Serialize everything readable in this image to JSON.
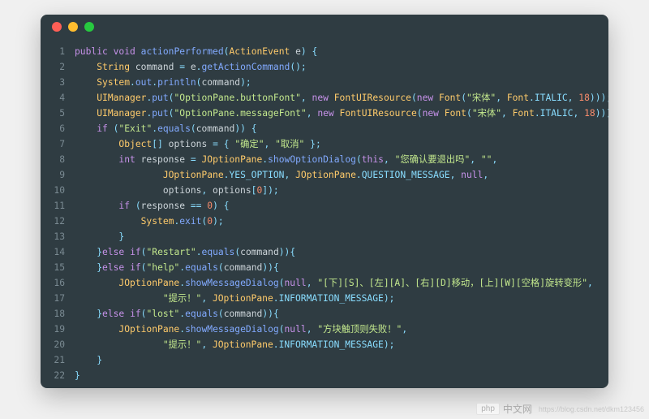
{
  "window": {
    "dots": [
      "red",
      "yellow",
      "green"
    ]
  },
  "code": {
    "lines": [
      {
        "n": 1,
        "tokens": [
          [
            "kw",
            "public"
          ],
          [
            "",
            ""
          ],
          [
            "kw",
            " void"
          ],
          [
            "",
            " "
          ],
          [
            "field",
            "actionPerformed"
          ],
          [
            "punct",
            "("
          ],
          [
            "type",
            "ActionEvent"
          ],
          [
            "",
            " e"
          ],
          [
            "punct",
            ")"
          ],
          [
            "",
            " "
          ],
          [
            "punct",
            "{"
          ]
        ]
      },
      {
        "n": 2,
        "tokens": [
          [
            "",
            "    "
          ],
          [
            "type",
            "String"
          ],
          [
            "",
            " command "
          ],
          [
            "punct",
            "="
          ],
          [
            "",
            " e"
          ],
          [
            "punct",
            "."
          ],
          [
            "field",
            "getActionCommand"
          ],
          [
            "punct",
            "();"
          ]
        ]
      },
      {
        "n": 3,
        "tokens": [
          [
            "",
            "    "
          ],
          [
            "type",
            "System"
          ],
          [
            "punct",
            "."
          ],
          [
            "field",
            "out"
          ],
          [
            "punct",
            "."
          ],
          [
            "field",
            "println"
          ],
          [
            "punct",
            "("
          ],
          [
            "",
            "command"
          ],
          [
            "punct",
            ");"
          ]
        ]
      },
      {
        "n": 4,
        "tokens": [
          [
            "",
            "    "
          ],
          [
            "type",
            "UIManager"
          ],
          [
            "punct",
            "."
          ],
          [
            "field",
            "put"
          ],
          [
            "punct",
            "("
          ],
          [
            "str",
            "\"OptionPane.buttonFont\""
          ],
          [
            "punct",
            ", "
          ],
          [
            "kw",
            "new"
          ],
          [
            "",
            " "
          ],
          [
            "type",
            "FontUIResource"
          ],
          [
            "punct",
            "("
          ],
          [
            "kw",
            "new"
          ],
          [
            "",
            " "
          ],
          [
            "type",
            "Font"
          ],
          [
            "punct",
            "("
          ],
          [
            "str",
            "\"宋体\""
          ],
          [
            "punct",
            ", "
          ],
          [
            "type",
            "Font"
          ],
          [
            "punct",
            "."
          ],
          [
            "const",
            "ITALIC"
          ],
          [
            "punct",
            ", "
          ],
          [
            "num",
            "18"
          ],
          [
            "punct",
            ")));"
          ]
        ]
      },
      {
        "n": 5,
        "tokens": [
          [
            "",
            "    "
          ],
          [
            "type",
            "UIManager"
          ],
          [
            "punct",
            "."
          ],
          [
            "field",
            "put"
          ],
          [
            "punct",
            "("
          ],
          [
            "str",
            "\"OptionPane.messageFont\""
          ],
          [
            "punct",
            ", "
          ],
          [
            "kw",
            "new"
          ],
          [
            "",
            " "
          ],
          [
            "type",
            "FontUIResource"
          ],
          [
            "punct",
            "("
          ],
          [
            "kw",
            "new"
          ],
          [
            "",
            " "
          ],
          [
            "type",
            "Font"
          ],
          [
            "punct",
            "("
          ],
          [
            "str",
            "\"宋体\""
          ],
          [
            "punct",
            ", "
          ],
          [
            "type",
            "Font"
          ],
          [
            "punct",
            "."
          ],
          [
            "const",
            "ITALIC"
          ],
          [
            "punct",
            ", "
          ],
          [
            "num",
            "18"
          ],
          [
            "punct",
            ")));"
          ]
        ]
      },
      {
        "n": 6,
        "tokens": [
          [
            "",
            "    "
          ],
          [
            "kw",
            "if"
          ],
          [
            "",
            " "
          ],
          [
            "punct",
            "("
          ],
          [
            "str",
            "\"Exit\""
          ],
          [
            "punct",
            "."
          ],
          [
            "field",
            "equals"
          ],
          [
            "punct",
            "("
          ],
          [
            "",
            "command"
          ],
          [
            "punct",
            "))"
          ],
          [
            "",
            " "
          ],
          [
            "punct",
            "{"
          ]
        ]
      },
      {
        "n": 7,
        "tokens": [
          [
            "",
            "        "
          ],
          [
            "type",
            "Object"
          ],
          [
            "punct",
            "[]"
          ],
          [
            "",
            " options "
          ],
          [
            "punct",
            "="
          ],
          [
            "",
            " "
          ],
          [
            "punct",
            "{"
          ],
          [
            "",
            " "
          ],
          [
            "str",
            "\"确定\""
          ],
          [
            "punct",
            ", "
          ],
          [
            "str",
            "\"取消\""
          ],
          [
            "",
            " "
          ],
          [
            "punct",
            "};"
          ]
        ]
      },
      {
        "n": 8,
        "tokens": [
          [
            "",
            "        "
          ],
          [
            "kw",
            "int"
          ],
          [
            "",
            " response "
          ],
          [
            "punct",
            "="
          ],
          [
            "",
            " "
          ],
          [
            "type",
            "JOptionPane"
          ],
          [
            "punct",
            "."
          ],
          [
            "field",
            "showOptionDialog"
          ],
          [
            "punct",
            "("
          ],
          [
            "kw",
            "this"
          ],
          [
            "punct",
            ", "
          ],
          [
            "str",
            "\"您确认要退出吗\""
          ],
          [
            "punct",
            ", "
          ],
          [
            "str",
            "\"\""
          ],
          [
            "punct",
            ","
          ]
        ]
      },
      {
        "n": 9,
        "tokens": [
          [
            "",
            "                "
          ],
          [
            "type",
            "JOptionPane"
          ],
          [
            "punct",
            "."
          ],
          [
            "const",
            "YES_OPTION"
          ],
          [
            "punct",
            ", "
          ],
          [
            "type",
            "JOptionPane"
          ],
          [
            "punct",
            "."
          ],
          [
            "const",
            "QUESTION_MESSAGE"
          ],
          [
            "punct",
            ", "
          ],
          [
            "null",
            "null"
          ],
          [
            "punct",
            ","
          ]
        ]
      },
      {
        "n": 10,
        "tokens": [
          [
            "",
            "                options"
          ],
          [
            "punct",
            ", "
          ],
          [
            "",
            "options"
          ],
          [
            "punct",
            "["
          ],
          [
            "num",
            "0"
          ],
          [
            "punct",
            "]);"
          ]
        ]
      },
      {
        "n": 11,
        "tokens": [
          [
            "",
            "        "
          ],
          [
            "kw",
            "if"
          ],
          [
            "",
            " "
          ],
          [
            "punct",
            "("
          ],
          [
            "",
            "response "
          ],
          [
            "punct",
            "=="
          ],
          [
            "",
            " "
          ],
          [
            "num",
            "0"
          ],
          [
            "punct",
            ")"
          ],
          [
            "",
            " "
          ],
          [
            "punct",
            "{"
          ]
        ]
      },
      {
        "n": 12,
        "tokens": [
          [
            "",
            "            "
          ],
          [
            "type",
            "System"
          ],
          [
            "punct",
            "."
          ],
          [
            "field",
            "exit"
          ],
          [
            "punct",
            "("
          ],
          [
            "num",
            "0"
          ],
          [
            "punct",
            ");"
          ]
        ]
      },
      {
        "n": 13,
        "tokens": [
          [
            "",
            "        "
          ],
          [
            "punct",
            "}"
          ]
        ]
      },
      {
        "n": 14,
        "tokens": [
          [
            "",
            "    "
          ],
          [
            "punct",
            "}"
          ],
          [
            "kw",
            "else"
          ],
          [
            "",
            " "
          ],
          [
            "kw",
            "if"
          ],
          [
            "punct",
            "("
          ],
          [
            "str",
            "\"Restart\""
          ],
          [
            "punct",
            "."
          ],
          [
            "field",
            "equals"
          ],
          [
            "punct",
            "("
          ],
          [
            "",
            "command"
          ],
          [
            "punct",
            ")){"
          ]
        ]
      },
      {
        "n": 15,
        "tokens": [
          [
            "",
            "    "
          ],
          [
            "punct",
            "}"
          ],
          [
            "kw",
            "else"
          ],
          [
            "",
            " "
          ],
          [
            "kw",
            "if"
          ],
          [
            "punct",
            "("
          ],
          [
            "str",
            "\"help\""
          ],
          [
            "punct",
            "."
          ],
          [
            "field",
            "equals"
          ],
          [
            "punct",
            "("
          ],
          [
            "",
            "command"
          ],
          [
            "punct",
            ")){"
          ]
        ]
      },
      {
        "n": 16,
        "tokens": [
          [
            "",
            "        "
          ],
          [
            "type",
            "JOptionPane"
          ],
          [
            "punct",
            "."
          ],
          [
            "field",
            "showMessageDialog"
          ],
          [
            "punct",
            "("
          ],
          [
            "null",
            "null"
          ],
          [
            "punct",
            ", "
          ],
          [
            "str",
            "\"[下][S]、[左][A]、[右][D]移动，[上][W][空格]旋转变形\""
          ],
          [
            "punct",
            ","
          ]
        ]
      },
      {
        "n": 17,
        "tokens": [
          [
            "",
            "                "
          ],
          [
            "str",
            "\"提示！\""
          ],
          [
            "punct",
            ", "
          ],
          [
            "type",
            "JOptionPane"
          ],
          [
            "punct",
            "."
          ],
          [
            "const",
            "INFORMATION_MESSAGE"
          ],
          [
            "punct",
            ");"
          ]
        ]
      },
      {
        "n": 18,
        "tokens": [
          [
            "",
            "    "
          ],
          [
            "punct",
            "}"
          ],
          [
            "kw",
            "else"
          ],
          [
            "",
            " "
          ],
          [
            "kw",
            "if"
          ],
          [
            "punct",
            "("
          ],
          [
            "str",
            "\"lost\""
          ],
          [
            "punct",
            "."
          ],
          [
            "field",
            "equals"
          ],
          [
            "punct",
            "("
          ],
          [
            "",
            "command"
          ],
          [
            "punct",
            ")){"
          ]
        ]
      },
      {
        "n": 19,
        "tokens": [
          [
            "",
            "        "
          ],
          [
            "type",
            "JOptionPane"
          ],
          [
            "punct",
            "."
          ],
          [
            "field",
            "showMessageDialog"
          ],
          [
            "punct",
            "("
          ],
          [
            "null",
            "null"
          ],
          [
            "punct",
            ", "
          ],
          [
            "str",
            "\"方块触顶则失败！\""
          ],
          [
            "punct",
            ","
          ]
        ]
      },
      {
        "n": 20,
        "tokens": [
          [
            "",
            "                "
          ],
          [
            "str",
            "\"提示！\""
          ],
          [
            "punct",
            ", "
          ],
          [
            "type",
            "JOptionPane"
          ],
          [
            "punct",
            "."
          ],
          [
            "const",
            "INFORMATION_MESSAGE"
          ],
          [
            "punct",
            ");"
          ]
        ]
      },
      {
        "n": 21,
        "tokens": [
          [
            "",
            "    "
          ],
          [
            "punct",
            "}"
          ]
        ]
      },
      {
        "n": 22,
        "tokens": [
          [
            "punct",
            "}"
          ]
        ]
      }
    ]
  },
  "watermark": {
    "logo": "php",
    "zh": "中文网",
    "url": "https://blog.csdn.net/dkm123456"
  }
}
